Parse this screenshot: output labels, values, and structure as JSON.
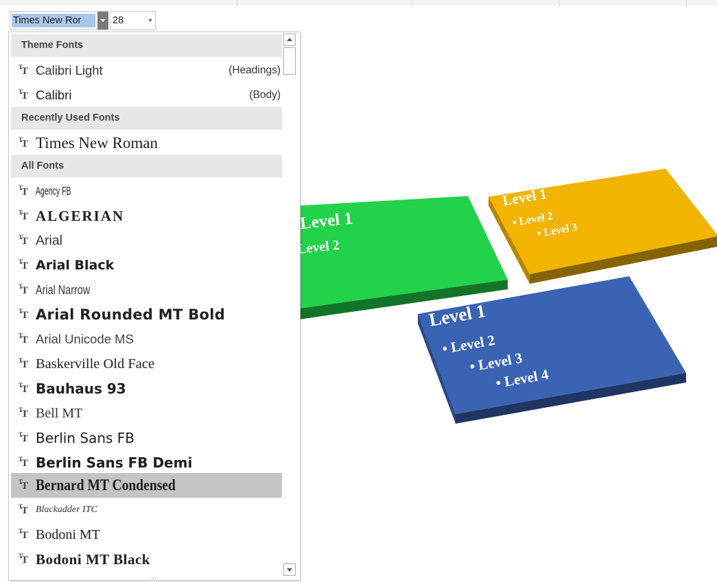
{
  "toolbar": {
    "font_name": "Times New Ror",
    "font_size": "28"
  },
  "dropdown": {
    "sections": {
      "theme": "Theme Fonts",
      "recent": "Recently Used Fonts",
      "all": "All Fonts"
    },
    "theme_fonts": [
      {
        "name": "Calibri Light",
        "tag": "(Headings)"
      },
      {
        "name": "Calibri",
        "tag": "(Body)"
      }
    ],
    "recent_fonts": [
      "Times New Roman"
    ],
    "all_fonts": [
      "Agency FB",
      "ALGERIAN",
      "Arial",
      "Arial Black",
      "Arial Narrow",
      "Arial Rounded MT Bold",
      "Arial Unicode MS",
      "Baskerville Old Face",
      "Bauhaus 93",
      "Bell MT",
      "Berlin Sans FB",
      "Berlin Sans FB Demi",
      "Bernard MT Condensed",
      "Blackadder ITC",
      "Bodoni MT",
      "Bodoni MT Black"
    ],
    "selected_font": "Bernard MT Condensed",
    "grip": "....",
    "icon": "truetype-font-icon"
  },
  "slides": {
    "green": {
      "color": "#22d24a",
      "lines": [
        "Level 1",
        "Level 2"
      ]
    },
    "orange": {
      "color": "#f2b400",
      "lines": [
        "Level 1",
        "• Level 2",
        "• Level 3"
      ]
    },
    "blue": {
      "color": "#3b63b3",
      "lines": [
        "Level 1",
        "• Level 2",
        "• Level 3",
        "• Level 4"
      ]
    }
  }
}
